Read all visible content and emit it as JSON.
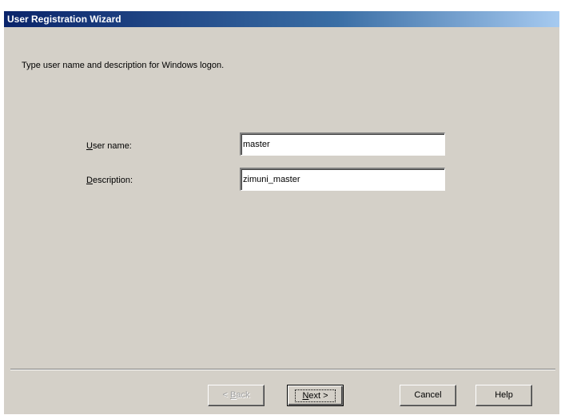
{
  "window": {
    "title": "User Registration Wizard"
  },
  "page": {
    "instruction": "Type user name and description for Windows logon."
  },
  "fields": {
    "username": {
      "label_mnemonic": "U",
      "label_rest": "ser name:",
      "value": "master"
    },
    "description": {
      "label_mnemonic": "D",
      "label_rest": "escription:",
      "value": "zimuni_master"
    }
  },
  "buttons": {
    "back": {
      "mnemonic": "B",
      "prefix": "< ",
      "rest": "ack"
    },
    "next": {
      "mnemonic": "N",
      "rest": "ext >"
    },
    "cancel": "Cancel",
    "help": "Help"
  }
}
